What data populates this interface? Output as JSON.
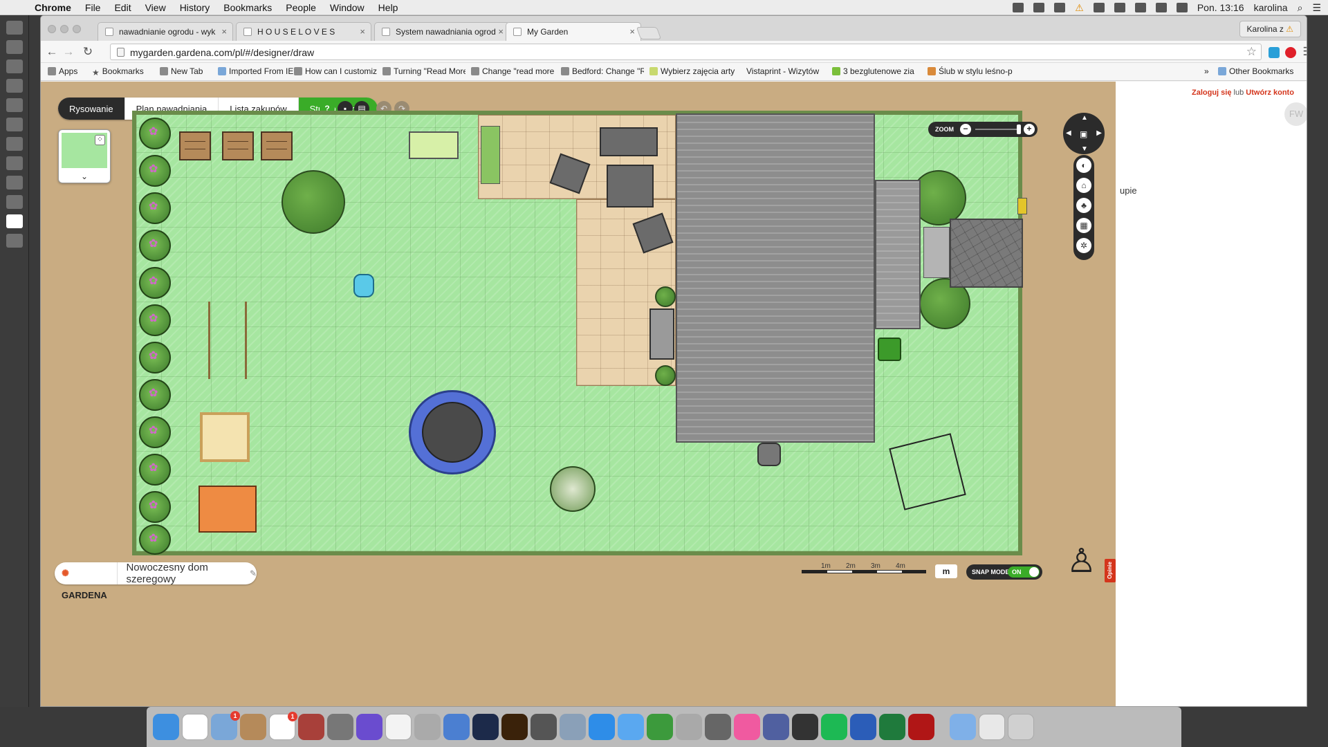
{
  "menubar": {
    "app": "Chrome",
    "items": [
      "File",
      "Edit",
      "View",
      "History",
      "Bookmarks",
      "People",
      "Window",
      "Help"
    ],
    "clock": "Pon. 13:16",
    "user": "karolina"
  },
  "tabs": [
    {
      "title": "nawadnianie ogrodu - wyk"
    },
    {
      "title": "H O U S E L O V E S"
    },
    {
      "title": "System nawadniania ogrod"
    },
    {
      "title": "My Garden"
    }
  ],
  "profile": "Karolina z",
  "address": "mygarden.gardena.com/pl/#/designer/draw",
  "bookmarks": {
    "items": [
      "Apps",
      "Bookmarks",
      "New Tab",
      "Imported From IE",
      "How can I customize",
      "Turning \"Read More\"",
      "Change \"read more\"",
      "Bedford: Change \"Re",
      "Wybierz zajęcia arty",
      "Vistaprint - Wizytów",
      "3 bezglutenowe zia",
      "Ślub w stylu leśno-p"
    ],
    "overflow": "»",
    "other": "Other Bookmarks"
  },
  "app": {
    "login": "Zaloguj się",
    "or": "lub",
    "create": "Utwórz konto",
    "avatar": "FW",
    "modes": [
      "Rysowanie",
      "Plan nawadniania",
      "Lista zakupów",
      "Strona ogrodu"
    ],
    "help": "?",
    "zoom_label": "ZOOM",
    "scale_labels": [
      "1m",
      "2m",
      "3m",
      "4m"
    ],
    "unit": "m",
    "snap_label": "SNAP MODE",
    "snap_value": "ON",
    "brand": "GARDENA",
    "project_name": "Nowoczesny dom szeregowy",
    "feedback": "Opinie",
    "cut_text": "upie"
  },
  "icons": {
    "apple": "apple-icon",
    "search": "search-icon",
    "reload": "reload-icon",
    "back": "back-arrow-icon",
    "forward": "forward-arrow-icon"
  },
  "colors": {
    "accent_green": "#3aac28",
    "login_red": "#d4351c",
    "grass": "#a6e6a0"
  }
}
